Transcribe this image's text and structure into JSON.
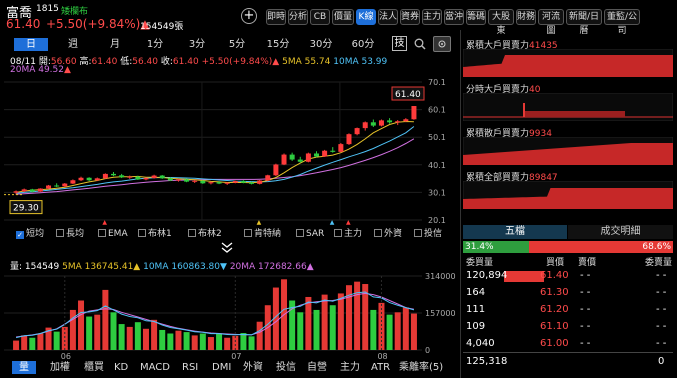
{
  "header": {
    "name": "富喬",
    "code": "1815",
    "tag": "矮欄布",
    "price": "61.40",
    "change": "+5.50(+9.84%)▲",
    "volume": "154549張"
  },
  "nav_tabs": [
    "即時",
    "分析",
    "CB",
    "價量",
    "K線",
    "法人",
    "資券",
    "主力",
    "當沖",
    "籌碼",
    "大股東",
    "財務",
    "河流圖",
    "新聞/日曆",
    "董監/公司"
  ],
  "active_tab": "K線",
  "timeframes": [
    "日",
    "週",
    "月",
    "1分",
    "3分",
    "5分",
    "15分",
    "30分",
    "60分"
  ],
  "active_timeframe": "日",
  "tech_label": "技",
  "ohlc": {
    "date": "08/11",
    "open_label": "開:",
    "open": "56.60",
    "high_label": "高:",
    "high": "61.40",
    "low_label": "低:",
    "low": "56.40",
    "close_label": "收:",
    "close": "61.40",
    "change": "+5.50(+9.84%)",
    "ma5": "5MA 55.74",
    "ma10": "10MA 53.99",
    "ma20": "20MA 49.52"
  },
  "price_axis": [
    "70.1",
    "60.1",
    "50.1",
    "40.1",
    "30.1",
    "20.1"
  ],
  "price_labels": {
    "last": "61.40",
    "low": "29.30"
  },
  "indicators": [
    "短均",
    "長均",
    "EMA",
    "布林1",
    "布林2",
    "肯特納",
    "SAR",
    "主力",
    "外資",
    "投信"
  ],
  "volume_info": {
    "label": "量: 154549",
    "ma5": "5MA 136745.41▲",
    "ma10": "10MA 160863.80▼",
    "ma20": "20MA 172682.66▲"
  },
  "volume_axis": [
    "314000",
    "157000",
    "0"
  ],
  "x_labels": [
    "06",
    "07",
    "08"
  ],
  "bottom_tabs": [
    "量",
    "加權",
    "櫃買",
    "KD",
    "MACD",
    "RSI",
    "DMI",
    "外資",
    "投信",
    "自營",
    "主力",
    "ATR",
    "乘離率(5)"
  ],
  "active_bottom_tab": "量",
  "side_panels": [
    {
      "title": "累積大戶買賣力",
      "value": "41435"
    },
    {
      "title": "分時大戶買賣力",
      "value": "40"
    },
    {
      "title": "累積散戶買賣力",
      "value": "9934"
    },
    {
      "title": "累積全部買賣力",
      "value": "89847"
    }
  ],
  "orderbook": {
    "tabs": [
      "五檔",
      "成交明細"
    ],
    "buy_pct": "31.4%",
    "sell_pct": "68.6%",
    "buy_ratio": 0.314,
    "headers": [
      "委買量",
      "買價",
      "賣價",
      "委賣量"
    ],
    "rows": [
      {
        "bid_qty": "120,894",
        "bid": "61.40",
        "ask": "- -",
        "ask_qty": "- -"
      },
      {
        "bid_qty": "164",
        "bid": "61.30",
        "ask": "- -",
        "ask_qty": "- -"
      },
      {
        "bid_qty": "111",
        "bid": "61.20",
        "ask": "- -",
        "ask_qty": "- -"
      },
      {
        "bid_qty": "109",
        "bid": "61.10",
        "ask": "- -",
        "ask_qty": "- -"
      },
      {
        "bid_qty": "4,040",
        "bid": "61.00",
        "ask": "- -",
        "ask_qty": "- -"
      }
    ],
    "total_bid": "125,318",
    "total_ask": "0"
  },
  "colors": {
    "up": "#ff4b4b",
    "down": "#2ecc40",
    "accent": "#1e6fd9",
    "ma5": "#e6c229",
    "ma10": "#4fc3f7",
    "ma20": "#d070e0"
  },
  "chart_data": {
    "type": "candlestick",
    "ylim": [
      20.1,
      70.1
    ],
    "candles": [
      [
        30,
        30.8,
        29.3,
        30.5
      ],
      [
        30.5,
        31.5,
        30.2,
        31.2
      ],
      [
        31.2,
        31.4,
        30.1,
        30.4
      ],
      [
        30.4,
        31.6,
        30.3,
        31.5
      ],
      [
        31.5,
        32.8,
        31.3,
        32.6
      ],
      [
        32.6,
        33.4,
        32,
        32.3
      ],
      [
        32.3,
        33.5,
        32.1,
        33.3
      ],
      [
        33.3,
        34.8,
        33.1,
        34.5
      ],
      [
        34.5,
        35.8,
        34.2,
        35.4
      ],
      [
        35.4,
        35.6,
        34.2,
        34.5
      ],
      [
        34.5,
        35.5,
        34.2,
        35.2
      ],
      [
        35.2,
        37,
        35,
        36.8
      ],
      [
        36.8,
        37.5,
        36,
        36.3
      ],
      [
        36.3,
        36.8,
        35.3,
        35.6
      ],
      [
        35.6,
        36.2,
        35,
        35.8
      ],
      [
        35.8,
        36.1,
        34.6,
        34.8
      ],
      [
        34.8,
        35.5,
        34.5,
        35.3
      ],
      [
        35.3,
        36.5,
        35.1,
        36.2
      ],
      [
        36.2,
        36.4,
        35,
        35.2
      ],
      [
        35.2,
        35.6,
        34.2,
        34.4
      ],
      [
        34.4,
        35,
        34,
        34.8
      ],
      [
        34.8,
        35.1,
        33.8,
        34
      ],
      [
        34,
        34.6,
        33.5,
        34.3
      ],
      [
        34.3,
        34.5,
        33.2,
        33.4
      ],
      [
        33.4,
        34,
        33,
        33.8
      ],
      [
        33.8,
        34.2,
        33.1,
        33.3
      ],
      [
        33.3,
        33.8,
        32.8,
        33.6
      ],
      [
        33.6,
        34.4,
        33.4,
        34.2
      ],
      [
        34.2,
        34.5,
        33.4,
        33.6
      ],
      [
        33.6,
        34,
        33,
        33.2
      ],
      [
        33.2,
        34.6,
        33,
        34.4
      ],
      [
        34.4,
        36.5,
        34.2,
        36.3
      ],
      [
        36.3,
        40.5,
        36,
        40.2
      ],
      [
        40.2,
        44.2,
        40,
        43.8
      ],
      [
        43.8,
        44.5,
        41.5,
        42
      ],
      [
        42,
        43,
        40.8,
        41.2
      ],
      [
        41.2,
        44.5,
        41,
        44.2
      ],
      [
        44.2,
        45,
        42.8,
        43.1
      ],
      [
        43.1,
        45.5,
        43,
        45.2
      ],
      [
        45.2,
        46.5,
        44.5,
        44.8
      ],
      [
        44.8,
        48,
        44.6,
        47.6
      ],
      [
        47.6,
        51.5,
        47.3,
        51.2
      ],
      [
        51.2,
        53.6,
        50.8,
        53.4
      ],
      [
        53.4,
        55.8,
        52.5,
        55.5
      ],
      [
        55.5,
        56.5,
        53.8,
        54.3
      ],
      [
        54.3,
        56.5,
        54,
        56.2
      ],
      [
        56.2,
        57,
        55,
        55.5
      ],
      [
        55.5,
        56.3,
        54.5,
        55.9
      ],
      [
        55.9,
        57,
        55.6,
        56.6
      ],
      [
        56.6,
        61.4,
        56.4,
        61.4
      ]
    ],
    "ma5": [
      30.1,
      30.6,
      30.9,
      31.1,
      31.3,
      31.6,
      32,
      32.6,
      33.3,
      33.9,
      34.4,
      35.1,
      35.6,
      35.8,
      35.8,
      35.9,
      35.6,
      35.6,
      35.5,
      35.2,
      35,
      34.9,
      34.7,
      34.4,
      34.1,
      33.9,
      33.7,
      33.7,
      33.7,
      33.6,
      33.8,
      34.4,
      35.5,
      37.2,
      39.1,
      40.7,
      42.2,
      42.9,
      43.2,
      43.6,
      44.5,
      45.8,
      47.5,
      49.5,
      51.7,
      53.2,
      54.7,
      55.5,
      55.8,
      55.7
    ],
    "ma10": [
      29.8,
      30.1,
      30.3,
      30.6,
      30.9,
      31.2,
      31.5,
      31.8,
      32.2,
      32.6,
      33,
      33.5,
      33.9,
      34.2,
      34.6,
      35,
      35.2,
      35.4,
      35.5,
      35.5,
      35.4,
      35.3,
      35.2,
      35,
      34.8,
      34.6,
      34.4,
      34.2,
      34.1,
      34,
      33.9,
      34,
      34.3,
      34.8,
      35.6,
      36.6,
      37.8,
      38.9,
      40,
      41,
      42,
      43,
      43.9,
      44.9,
      46,
      47.4,
      48.7,
      50.2,
      51.7,
      53.99
    ],
    "ma20": [
      29.4,
      29.6,
      29.8,
      30,
      30.2,
      30.4,
      30.7,
      31,
      31.3,
      31.6,
      32,
      32.3,
      32.6,
      32.9,
      33.2,
      33.5,
      33.8,
      34,
      34.2,
      34.4,
      34.5,
      34.6,
      34.7,
      34.7,
      34.8,
      34.8,
      34.8,
      34.8,
      34.8,
      34.8,
      34.9,
      35,
      35.2,
      35.5,
      35.8,
      36.2,
      36.7,
      37.2,
      37.8,
      38.4,
      39.1,
      39.9,
      40.8,
      41.7,
      42.7,
      43.8,
      45,
      46.3,
      47.8,
      49.52
    ],
    "volume": [
      40000,
      62000,
      52000,
      70000,
      95000,
      78000,
      98000,
      170000,
      210000,
      142000,
      150000,
      255000,
      160000,
      110000,
      98000,
      118000,
      90000,
      128000,
      85000,
      70000,
      82000,
      76000,
      62000,
      70000,
      55000,
      68000,
      52000,
      60000,
      72000,
      58000,
      120000,
      190000,
      265000,
      300000,
      210000,
      160000,
      225000,
      170000,
      235000,
      190000,
      240000,
      275000,
      290000,
      280000,
      170000,
      200000,
      150000,
      160000,
      180000,
      154549
    ],
    "vol_ma": [
      55000,
      60000,
      64000,
      70000,
      80000,
      90000,
      110000,
      130000,
      150000,
      165000,
      170000,
      175000,
      172000,
      160000,
      150000,
      140000,
      130000,
      120000,
      110000,
      100000,
      92000,
      86000,
      80000,
      76000,
      72000,
      70000,
      68000,
      66000,
      65000,
      65000,
      75000,
      95000,
      120000,
      150000,
      175000,
      190000,
      200000,
      205000,
      208000,
      210000,
      215000,
      225000,
      235000,
      240000,
      235000,
      225000,
      210000,
      195000,
      180000,
      172682
    ],
    "vol_ylim": [
      0,
      314000
    ]
  }
}
